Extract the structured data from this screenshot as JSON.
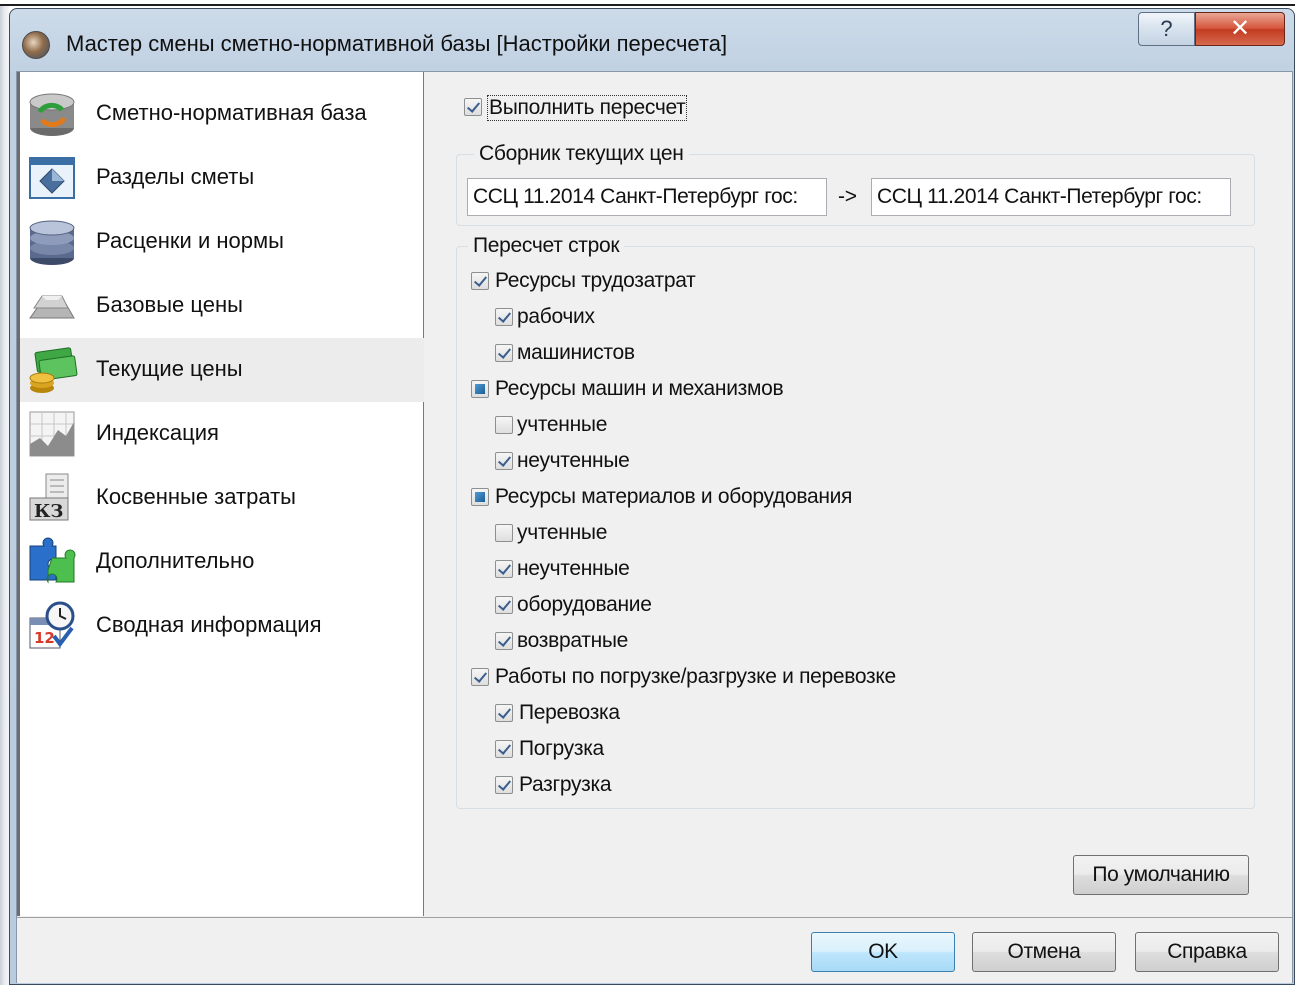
{
  "window": {
    "title": "Мастер смены сметно-нормативной базы [Настройки пересчета]",
    "help_glyph": "?",
    "close_glyph": "✕"
  },
  "nav": {
    "items": [
      {
        "label": "Сметно-нормативная база",
        "icon": "database-refresh-icon"
      },
      {
        "label": "Разделы сметы",
        "icon": "window-diamond-icon"
      },
      {
        "label": "Расценки и нормы",
        "icon": "database-disks-icon"
      },
      {
        "label": "Базовые цены",
        "icon": "gold-bars-icon"
      },
      {
        "label": "Текущие цены",
        "icon": "money-coins-icon",
        "selected": true
      },
      {
        "label": "Индексация",
        "icon": "chart-graph-icon"
      },
      {
        "label": "Косвенные затраты",
        "icon": "kz-calculator-icon"
      },
      {
        "label": "Дополнительно",
        "icon": "puzzle-icon"
      },
      {
        "label": "Сводная информация",
        "icon": "calendar-clock-icon",
        "kz_text": "КЗ",
        "cal_text": "12"
      }
    ]
  },
  "panel": {
    "recalc_label": "Выполнить пересчет",
    "recalc_checked": true,
    "prices_group_title": "Сборник текущих цен",
    "price_from": "ССЦ 11.2014 Санкт-Петербург гос:",
    "arrow": "->",
    "price_to": "ССЦ 11.2014 Санкт-Петербург гос:",
    "rows_group_title": "Пересчет строк",
    "rows": [
      {
        "label": "Ресурсы трудозатрат",
        "state": "checked",
        "level": 0
      },
      {
        "label": "рабочих",
        "state": "checked",
        "level": 1
      },
      {
        "label": "машинистов",
        "state": "checked",
        "level": 1
      },
      {
        "label": "Ресурсы машин и механизмов",
        "state": "mixed",
        "level": 0
      },
      {
        "label": "учтенные",
        "state": "unchecked",
        "level": 1
      },
      {
        "label": "неучтенные",
        "state": "checked",
        "level": 1
      },
      {
        "label": "Ресурсы материалов и оборудования",
        "state": "mixed",
        "level": 0
      },
      {
        "label": "учтенные",
        "state": "unchecked",
        "level": 1
      },
      {
        "label": "неучтенные",
        "state": "checked",
        "level": 1
      },
      {
        "label": "оборудование",
        "state": "checked",
        "level": 1
      },
      {
        "label": "возвратные",
        "state": "checked",
        "level": 1
      },
      {
        "label": "Работы по погрузке/разгрузке и перевозке",
        "state": "checked",
        "level": 0
      },
      {
        "label": "Перевозка",
        "state": "checked",
        "level": 1
      },
      {
        "label": "Погрузка",
        "state": "checked",
        "level": 1
      },
      {
        "label": "Разгрузка",
        "state": "checked",
        "level": 1
      }
    ],
    "default_button": "По умолчанию"
  },
  "buttons": {
    "ok": "OK",
    "cancel": "Отмена",
    "help": "Справка"
  }
}
